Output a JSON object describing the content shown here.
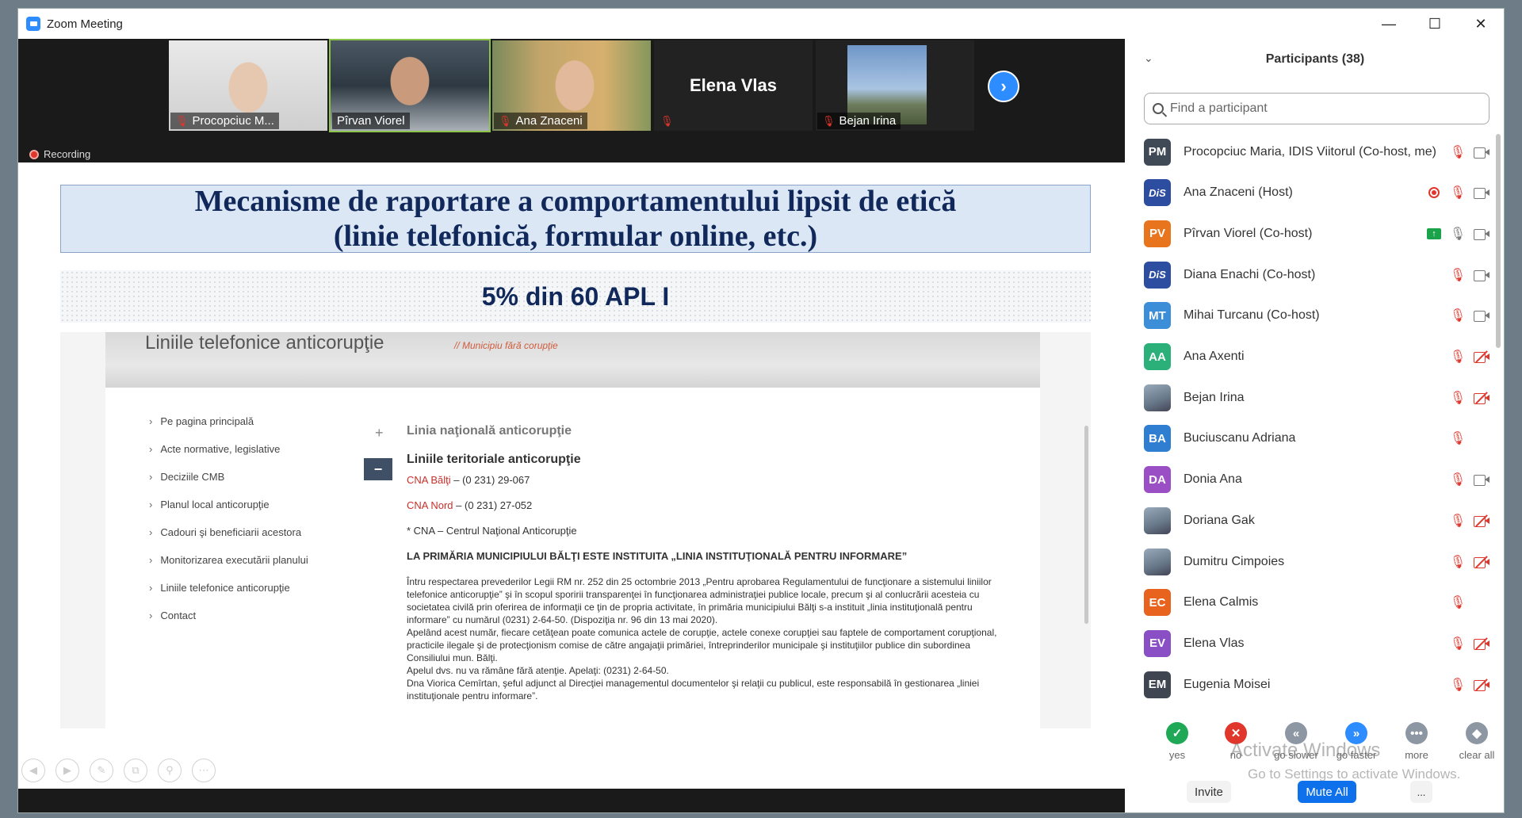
{
  "window": {
    "title": "Zoom Meeting"
  },
  "video_strip": {
    "tiles": [
      {
        "name": "Procopciuc M...",
        "muted": true
      },
      {
        "name": "Pîrvan Viorel",
        "muted": false
      },
      {
        "name": "Ana Znaceni",
        "muted": true
      },
      {
        "name": "",
        "center_name": "Elena Vlas",
        "muted": true
      },
      {
        "name": "Bejan Irina",
        "muted": true
      }
    ],
    "recording_label": "Recording"
  },
  "slide": {
    "title_line1": "Mecanisme de raportare a comportamentului lipsit de etică",
    "title_line2": "(linie telefonică, formular online, etc.)",
    "stat": "5% din 60 APL I",
    "site": {
      "header_title": "Liniile telefonice anticorupţie",
      "header_sub": "// Municipiu fără corupţie",
      "nav": [
        "Pe pagina principală",
        "Acte normative, legislative",
        "Deciziile CMB",
        "Planul local anticorupţie",
        "Cadouri şi beneficiarii acestora",
        "Monitorizarea executării planului",
        "Liniile telefonice anticorupţie",
        "Contact"
      ],
      "accordion_1": "Linia naţională anticorupţie",
      "accordion_2": "Liniile teritoriale anticorupţie",
      "cna_balti_link": "CNA Bălţi",
      "cna_balti_phone": " – (0 231) 29-067",
      "cna_nord_link": "CNA Nord",
      "cna_nord_phone": " – (0 231) 27-052",
      "cna_note": "* CNA – Centrul Naţional Anticorupţie",
      "bold_heading": "LA PRIMĂRIA MUNICIPIULUI BĂLŢI ESTE INSTITUITA „LINIA INSTITUŢIONALĂ PENTRU INFORMARE”",
      "para1": "Întru respectarea prevederilor Legii RM nr. 252 din 25 octombrie 2013 „Pentru aprobarea Regulamentului de funcţionare a sistemului liniilor telefonice anticorupţie” şi în scopul sporirii transparenţei în funcţionarea administraţiei publice locale, precum şi al conlucrării acesteia cu societatea civilă prin oferirea de informaţii ce ţin de propria activitate, în primăria municipiului Bălţi s-a instituit „linia instituţională pentru informare” cu numărul (0231) 2-64-50. (Dispoziţia nr. 96 din 13 mai 2020).",
      "para2": "Apelând acest număr, fiecare cetăţean poate comunica actele de corupţie, actele conexe corupţiei sau faptele de comportament corupţional, practicile ilegale şi de protecţionism comise de către angajaţii primăriei, întreprinderilor municipale şi instituţiilor publice din subordinea Consiliului mun. Bălţi.",
      "para3": "Apelul dvs. nu va rămâne fără atenţie. Apelaţi: (0231) 2-64-50.",
      "para4": "Dna Viorica Cemîrtan, şeful adjunct al Direcţiei managementul documentelor şi relaţii cu publicul, este responsabilă în gestionarea „liniei instituţionale pentru informare”."
    }
  },
  "participants": {
    "title": "Participants (38)",
    "search_placeholder": "Find a participant",
    "list": [
      {
        "initials": "PM",
        "color": "#404a56",
        "name": "Procopciuc Maria, IDIS Viitorul (Co-host, me)",
        "rec": false,
        "share": false,
        "mic": "off",
        "cam": "on"
      },
      {
        "initials": "DiS",
        "color": "#2c4da0",
        "name": "Ana Znaceni (Host)",
        "rec": true,
        "share": false,
        "mic": "off",
        "cam": "on",
        "logo": true
      },
      {
        "initials": "PV",
        "color": "#e8741e",
        "name": "Pîrvan Viorel (Co-host)",
        "rec": false,
        "share": true,
        "mic": "on",
        "cam": "on"
      },
      {
        "initials": "DiS",
        "color": "#2c4da0",
        "name": "Diana Enachi (Co-host)",
        "rec": false,
        "share": false,
        "mic": "off",
        "cam": "on",
        "logo": true
      },
      {
        "initials": "MT",
        "color": "#3c8ed8",
        "name": "Mihai Turcanu (Co-host)",
        "rec": false,
        "share": false,
        "mic": "off",
        "cam": "on"
      },
      {
        "initials": "AA",
        "color": "#2bb07a",
        "name": "Ana Axenti",
        "rec": false,
        "share": false,
        "mic": "off",
        "cam": "off"
      },
      {
        "initials": "",
        "color": "#6a88b2",
        "name": "Bejan Irina",
        "rec": false,
        "share": false,
        "mic": "off",
        "cam": "off",
        "photo": true
      },
      {
        "initials": "BA",
        "color": "#2f7ed1",
        "name": "Buciuscanu Adriana",
        "rec": false,
        "share": false,
        "mic": "off",
        "cam": "none"
      },
      {
        "initials": "DA",
        "color": "#9b4fc4",
        "name": "Donia Ana",
        "rec": false,
        "share": false,
        "mic": "off",
        "cam": "on"
      },
      {
        "initials": "",
        "color": "#3a4c8a",
        "name": "Doriana Gak",
        "rec": false,
        "share": false,
        "mic": "off",
        "cam": "off",
        "photo": true
      },
      {
        "initials": "",
        "color": "#8a8f96",
        "name": "Dumitru Cimpoies",
        "rec": false,
        "share": false,
        "mic": "off",
        "cam": "off",
        "photo": true
      },
      {
        "initials": "EC",
        "color": "#e8641e",
        "name": "Elena Calmis",
        "rec": false,
        "share": false,
        "mic": "off",
        "cam": "none"
      },
      {
        "initials": "EV",
        "color": "#8a4fc4",
        "name": "Elena Vlas",
        "rec": false,
        "share": false,
        "mic": "off",
        "cam": "off"
      },
      {
        "initials": "EM",
        "color": "#3f4652",
        "name": "Eugenia Moisei",
        "rec": false,
        "share": false,
        "mic": "off",
        "cam": "off"
      }
    ],
    "reactions": [
      {
        "label": "yes",
        "color": "#1fa855",
        "glyph": "✓"
      },
      {
        "label": "no",
        "color": "#e0362c",
        "glyph": "✕"
      },
      {
        "label": "go slower",
        "color": "#8d96a3",
        "glyph": "«"
      },
      {
        "label": "go faster",
        "color": "#2d8cff",
        "glyph": "»"
      },
      {
        "label": "more",
        "color": "#8d96a3",
        "glyph": "•••"
      },
      {
        "label": "clear all",
        "color": "#8d96a3",
        "glyph": "◆"
      }
    ],
    "invite_label": "Invite",
    "mute_all_label": "Mute All",
    "more_label": "..."
  },
  "watermark": {
    "line1": "Activate Windows",
    "line2": "Go to Settings to activate Windows."
  }
}
